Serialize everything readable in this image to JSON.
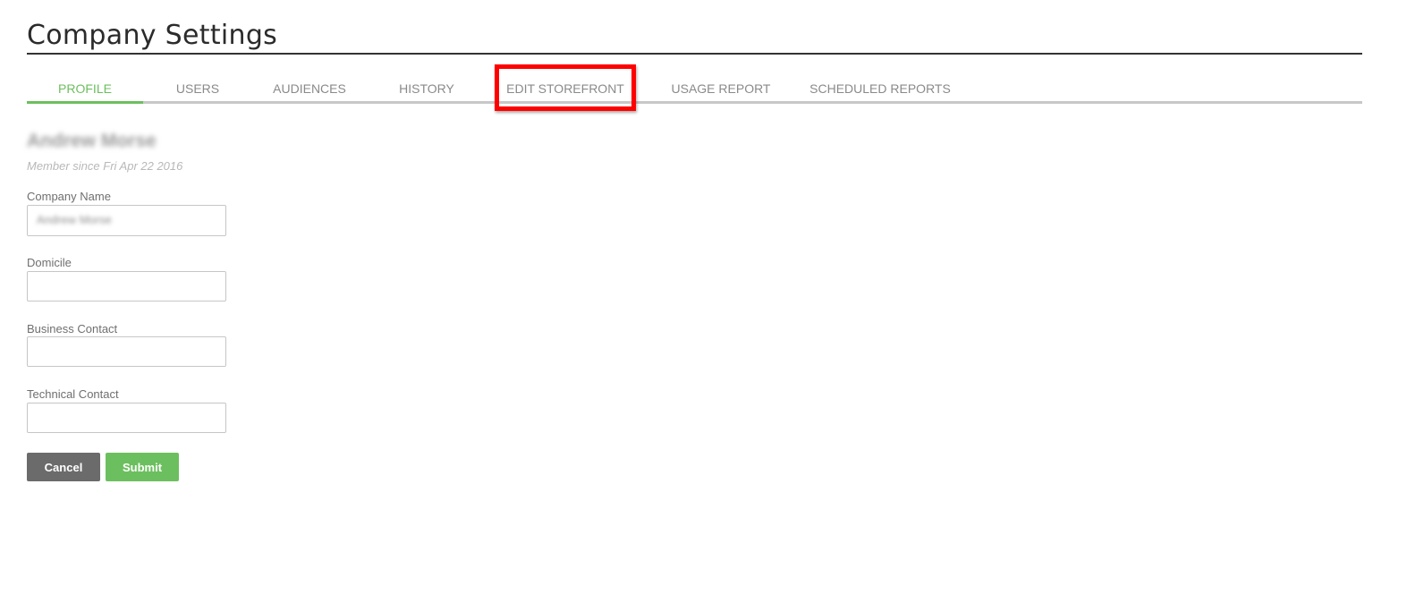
{
  "page": {
    "title": "Company Settings"
  },
  "tabs": [
    {
      "label": "PROFILE",
      "active": true
    },
    {
      "label": "USERS",
      "active": false
    },
    {
      "label": "AUDIENCES",
      "active": false
    },
    {
      "label": "HISTORY",
      "active": false
    },
    {
      "label": "EDIT STOREFRONT",
      "active": false,
      "highlighted": true
    },
    {
      "label": "USAGE REPORT",
      "active": false
    },
    {
      "label": "SCHEDULED REPORTS",
      "active": false
    }
  ],
  "profile": {
    "name": "Andrew Morse",
    "member_since": "Member since Fri Apr 22 2016"
  },
  "form": {
    "company_name": {
      "label": "Company Name",
      "value": "Andrew Morse"
    },
    "domicile": {
      "label": "Domicile",
      "value": ""
    },
    "business_contact": {
      "label": "Business Contact",
      "value": ""
    },
    "technical_contact": {
      "label": "Technical Contact",
      "value": ""
    }
  },
  "buttons": {
    "cancel": "Cancel",
    "submit": "Submit"
  },
  "colors": {
    "accent": "#6cbf5e",
    "cancel_bg": "#6b6b6b",
    "highlight": "#ff0000"
  }
}
